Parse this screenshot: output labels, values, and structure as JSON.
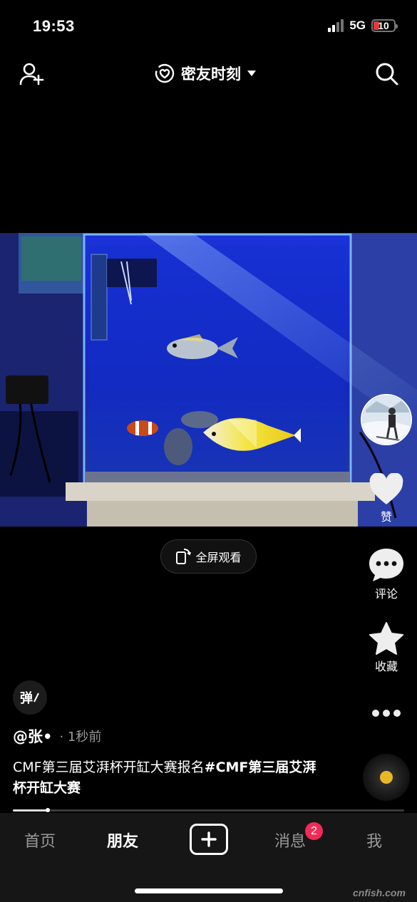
{
  "status_bar": {
    "time": "19:53",
    "network": "5G",
    "battery": "10"
  },
  "top_nav": {
    "mode_label": "密友时刻"
  },
  "video_player": {
    "fullscreen_label": "全屏观看"
  },
  "actions": {
    "like_label": "赞",
    "comment_label": "评论",
    "favorite_label": "收藏"
  },
  "danmaku": {
    "label": "弹"
  },
  "post": {
    "author": "@张•",
    "time_ago": "· 1秒前",
    "caption_text": "CMF第三届艾湃杯开缸大赛报名",
    "caption_tag": "#CMF第三届艾湃杯开缸大赛",
    "progress": 0.09
  },
  "tabbar": {
    "home": "首页",
    "friends": "朋友",
    "messages": "消息",
    "messages_badge": "2",
    "me": "我"
  },
  "watermark": "cnfish.com",
  "colors": {
    "accent_badge": "#f02c56",
    "music_disc_center": "#e8b824",
    "battery_low": "#e23a3a"
  },
  "icons": [
    "add-friend-icon",
    "heart-circle-icon",
    "dropdown-caret-icon",
    "search-icon",
    "rotate-phone-icon",
    "heart-icon",
    "comment-bubble-icon",
    "star-icon",
    "more-dots-icon",
    "plus-icon"
  ]
}
